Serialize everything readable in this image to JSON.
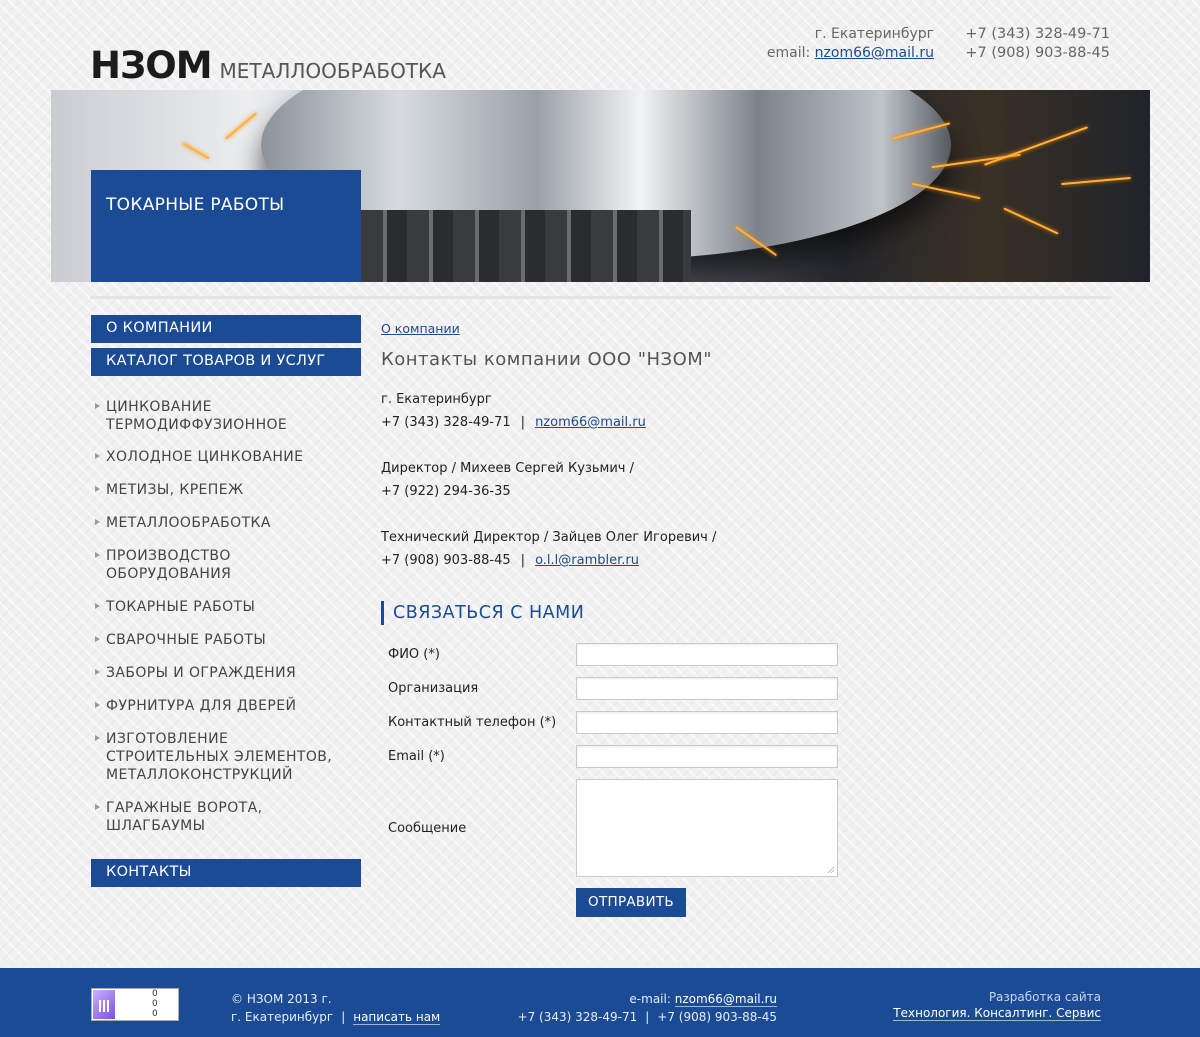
{
  "header": {
    "logo_main": "НЗОМ",
    "logo_sub": "МЕТАЛЛООБРАБОТКА",
    "city": "г. Екатеринбург",
    "email_label": "email:",
    "email": "nzom66@mail.ru",
    "phone1": "+7 (343) 328-49-71",
    "phone2": "+7 (908) 903-88-45"
  },
  "banner": {
    "title": "ТОКАРНЫЕ РАБОТЫ"
  },
  "sidebar": {
    "top_buttons": [
      "О КОМПАНИИ",
      "КАТАЛОГ ТОВАРОВ И УСЛУГ"
    ],
    "items": [
      "ЦИНКОВАНИЕ\nТЕРМОДИФФУЗИОННОЕ",
      "ХОЛОДНОЕ ЦИНКОВАНИЕ",
      "МЕТИЗЫ, КРЕПЕЖ",
      "МЕТАЛЛООБРАБОТКА",
      "ПРОИЗВОДСТВО\nОБОРУДОВАНИЯ",
      "ТОКАРНЫЕ РАБОТЫ",
      "СВАРОЧНЫЕ РАБОТЫ",
      "ЗАБОРЫ И ОГРАЖДЕНИЯ",
      "ФУРНИТУРА ДЛЯ ДВЕРЕЙ",
      "ИЗГОТОВЛЕНИЕ\nСТРОИТЕЛЬНЫХ ЭЛЕМЕНТОВ,\nМЕТАЛЛОКОНСТРУКЦИЙ",
      "ГАРАЖНЫЕ ВОРОТА,\nШЛАГБАУМЫ"
    ],
    "contacts_button": "КОНТАКТЫ"
  },
  "main": {
    "breadcrumb": "О компании",
    "title": "Контакты компании ООО \"НЗОМ\"",
    "city": "г. Екатеринбург",
    "phone_main": "+7 (343) 328-49-71",
    "sep": "|",
    "email_main": "nzom66@mail.ru",
    "director": "Директор / Михеев Сергей Кузьмич /",
    "director_phone": "+7 (922) 294-36-35",
    "tech_director": "Технический Директор / Зайцев Олег Игоревич /",
    "tech_phone": "+7 (908) 903-88-45",
    "tech_email": "o.l.l@rambler.ru"
  },
  "form": {
    "heading": "СВЯЗАТЬСЯ С НАМИ",
    "fields": {
      "fio": "ФИО (*)",
      "org": "Организация",
      "phone": "Контактный телефон (*)",
      "email": "Email (*)",
      "message": "Сообщение"
    },
    "submit": "ОТПРАВИТЬ"
  },
  "footer": {
    "copyright": "© НЗОМ 2013 г.",
    "city": "г. Екатеринбург",
    "sep": "|",
    "write_us": "написать нам",
    "email_label": "e-mail:",
    "email": "nzom66@mail.ru",
    "phone1": "+7 (343) 328-49-71",
    "phone2": "+7 (908) 903-88-45",
    "dev_label": "Разработка сайта",
    "dev_name": "Технология. Консалтинг. Сервис",
    "counter_nums": "0\n0\n0"
  },
  "colors": {
    "brand_blue": "#1c4b95",
    "link": "#1d4a8c"
  }
}
